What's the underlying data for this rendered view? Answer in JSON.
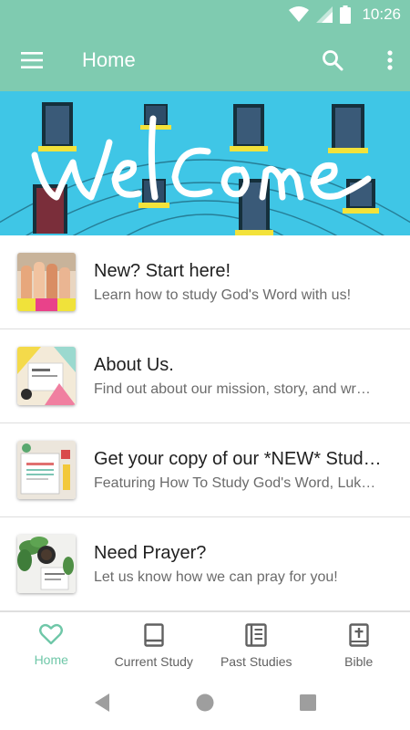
{
  "status_bar": {
    "time": "10:26",
    "icons": [
      "wifi-icon",
      "signal-icon",
      "battery-icon"
    ]
  },
  "app_bar": {
    "title": "Home",
    "icons": [
      "menu-icon",
      "search-icon",
      "more-vert-icon"
    ],
    "color": "#7fcbb0"
  },
  "banner": {
    "text": "welcome"
  },
  "list": {
    "items": [
      {
        "title": "New? Start here!",
        "subtitle": "Learn how to study God's Word with us!"
      },
      {
        "title": "About Us.",
        "subtitle": "Find out about our mission, story, and wr…"
      },
      {
        "title": "Get your copy of our *NEW* Stud…",
        "subtitle": "Featuring How To Study God's Word, Luk…"
      },
      {
        "title": "Need Prayer?",
        "subtitle": "Let us know how we can pray for you!"
      }
    ]
  },
  "bottom_nav": {
    "items": [
      {
        "label": "Home",
        "icon": "heart-icon",
        "active": true
      },
      {
        "label": "Current Study",
        "icon": "book-icon",
        "active": false
      },
      {
        "label": "Past Studies",
        "icon": "books-icon",
        "active": false
      },
      {
        "label": "Bible",
        "icon": "bible-icon",
        "active": false
      }
    ],
    "active_color": "#6fc7a8"
  },
  "system_nav": {
    "icons": [
      "back-icon",
      "home-circle-icon",
      "recents-icon"
    ]
  }
}
